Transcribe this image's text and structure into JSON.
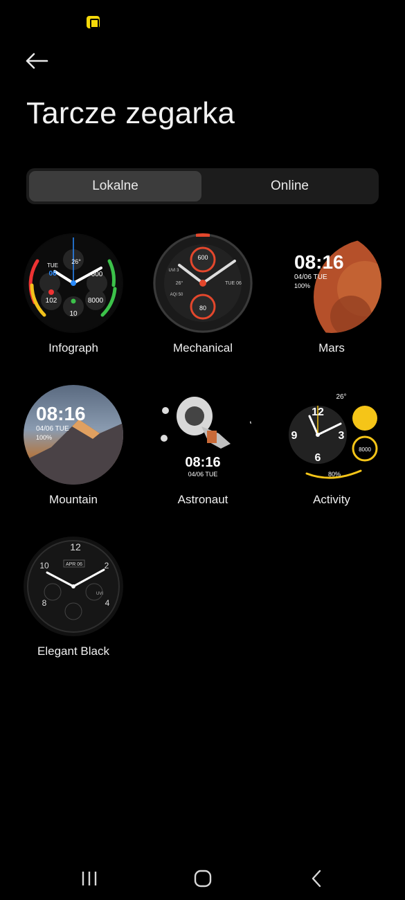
{
  "page": {
    "title": "Tarcze zegarka"
  },
  "tabs": [
    {
      "label": "Lokalne",
      "active": true
    },
    {
      "label": "Online",
      "active": false
    }
  ],
  "faces": [
    {
      "name": "Infograph",
      "date_day": "TUE",
      "date_num": "06",
      "weather": "26°",
      "calories": "600",
      "heart_rate": "102",
      "steps": "8000",
      "stand": "10"
    },
    {
      "name": "Mechanical",
      "top_value": "600",
      "uvi": "UVI 3",
      "temp": "26°",
      "aqi": "AQI 50",
      "day": "TUE 06",
      "bottom_value": "80"
    },
    {
      "name": "Mars",
      "time": "08:16",
      "date": "04/06 TUE",
      "battery": "100%"
    },
    {
      "name": "Mountain",
      "time": "08:16",
      "date": "04/06 TUE",
      "battery": "100%"
    },
    {
      "name": "Astronaut",
      "time": "08:16",
      "date": "04/06 TUE"
    },
    {
      "name": "Activity",
      "temp": "26°",
      "hours": [
        "12",
        "3",
        "6",
        "9"
      ],
      "steps": "8000",
      "battery": "80%"
    },
    {
      "name": "Elegant Black",
      "date": "APR 06",
      "hours": [
        "12",
        "2",
        "4",
        "8",
        "10"
      ],
      "uvi": "UVI"
    }
  ],
  "colors": {
    "background": "#000000",
    "tab_bg": "#1c1c1c",
    "tab_active": "#3c3c3c",
    "accent_yellow": "#f5d90a"
  },
  "icons": {
    "back": "arrow-left-icon",
    "recents": "recent-apps-icon",
    "home": "home-icon",
    "nav_back": "chevron-left-icon"
  }
}
